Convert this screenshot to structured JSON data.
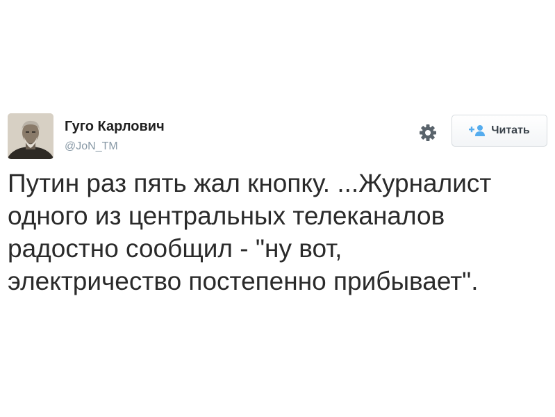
{
  "tweet": {
    "user": {
      "name": "Гуго Карлович",
      "handle": "@JoN_TM"
    },
    "follow_button": {
      "label": "Читать",
      "icon": "add-user-icon"
    },
    "settings_icon": "gear-icon",
    "text_lines": [
      "Путин раз пять жал кнопку. ...Журналист",
      "одного из центральных телеканалов",
      "радостно сообщил - \"ну вот,",
      "электричество постепенно прибывает\"."
    ]
  },
  "colors": {
    "accent": "#55acee",
    "handle": "#8899a6",
    "text": "#2a2a2a"
  }
}
